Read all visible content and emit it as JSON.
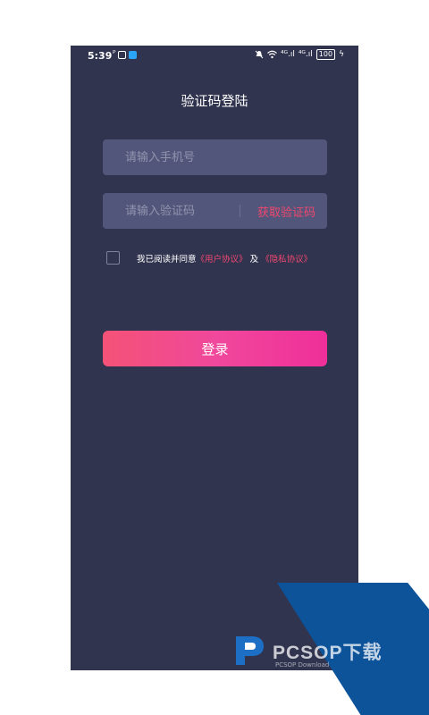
{
  "status_bar": {
    "time": "5:39",
    "signal_1": "⁴ᴳ.ıl",
    "signal_2": "⁴ᴳ.ıl",
    "battery": "100"
  },
  "page": {
    "title": "验证码登陆"
  },
  "form": {
    "phone_placeholder": "请输入手机号",
    "code_placeholder": "请输入验证码",
    "get_code_label": "获取验证码",
    "agree_prefix": "我已阅读并同意",
    "user_agreement": "《用户协议》",
    "and_text": "及",
    "privacy_policy": "《隐私协议》",
    "login_label": "登录"
  },
  "watermark": {
    "brand": "PCSOP下载",
    "url": "PCSOP Download"
  },
  "colors": {
    "background": "#31344f",
    "field": "#52567a",
    "accent": "#f0476f",
    "button_start": "#f45277",
    "button_end": "#ef2f9a",
    "watermark_blue": "#0c539a"
  },
  "icons": [
    "mute-bell-icon",
    "wifi-icon",
    "signal-icon",
    "battery-icon",
    "charging-icon"
  ]
}
